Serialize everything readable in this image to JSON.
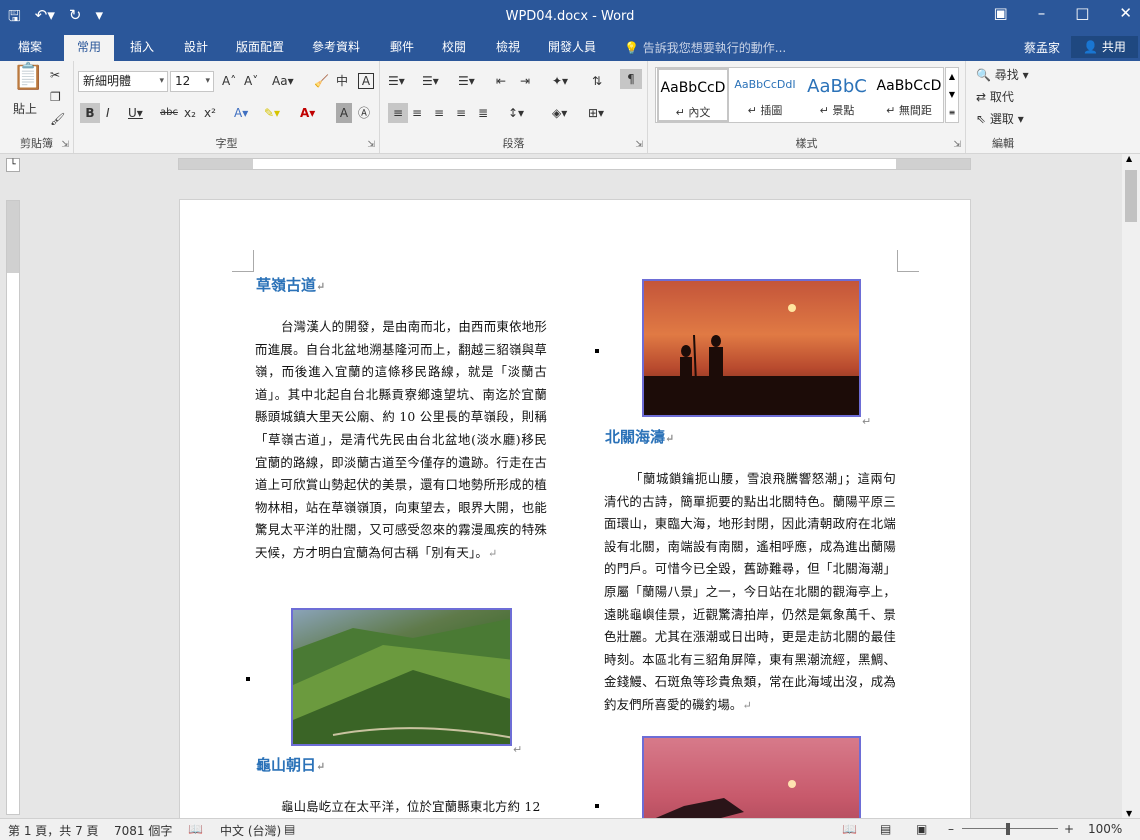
{
  "title": "WPD04.docx - Word",
  "tabs": [
    "檔案",
    "常用",
    "插入",
    "設計",
    "版面配置",
    "參考資料",
    "郵件",
    "校閱",
    "檢視",
    "開發人員"
  ],
  "tell_me": "告訴我您想要執行的動作...",
  "user": "蔡孟家",
  "share": "共用",
  "ribbon": {
    "paste": "貼上",
    "clipboard": "剪貼簿",
    "font_name": "新細明體",
    "font_size": "12",
    "font_group": "字型",
    "paragraph_group": "段落",
    "styles_group": "樣式",
    "editing_group": "編輯",
    "find": "尋找",
    "replace": "取代",
    "select": "選取",
    "styles": [
      {
        "preview": "AaBbCcD",
        "name": "↵ 內文"
      },
      {
        "preview": "AaBbCcDdI",
        "name": "↵ 插圖"
      },
      {
        "preview": "AaBbC",
        "name": "↵ 景點"
      },
      {
        "preview": "AaBbCcD",
        "name": "↵ 無間距"
      }
    ]
  },
  "document": {
    "heading1": "草嶺古道",
    "para1": "台灣漢人的開發，是由南而北，由西而東依地形而進展。自台北盆地溯基隆河而上，翻越三貂嶺與草嶺，而後進入宜蘭的這條移民路線，就是「淡蘭古道」。其中北起自台北縣貢寮鄉遠望坑、南迄於宜蘭縣頭城鎮大里天公廟、約 10 公里長的草嶺段，則稱「草嶺古道」，是清代先民由台北盆地(淡水廳)移民宜蘭的路線，即淡蘭古道至今僅存的遺跡。行走在古道上可欣賞山勢起伏的美景，還有口地勢所形成的植物林相，站在草嶺嶺頂，向東望去，眼界大開，也能驚見太平洋的壯闊，又可感受忽來的霧漫風疾的特殊天候，方才明白宜蘭為何古稱「別有天」。",
    "heading2": "龜山朝日",
    "para2": "龜山島屹立在太平洋，位於宜蘭縣東北方約 12",
    "heading3": "北關海濤",
    "para3": "「蘭城鎖鑰扼山腰，雪浪飛騰響怒潮」；這兩句清代的古詩，簡單扼要的點出北關特色。蘭陽平原三面環山，東臨大海，地形封閉，因此清朝政府在北端設有北關，南端設有南關，遙相呼應，成為進出蘭陽的門戶。可惜今已全毀，舊跡難尋，但「北關海潮」原屬「蘭陽八景」之一，今日站在北關的觀海亭上，遠眺龜嶼佳景，近觀驚濤拍岸，仍然是氣象萬千、景色壯麗。尤其在漲潮或日出時，更是走訪北關的最佳時刻。本區北有三貂角屏障，東有黑潮流經，黑鯛、金錢鰻、石斑魚等珍貴魚類，常在此海域出沒，成為釣友們所喜愛的磯釣場。"
  },
  "status": {
    "page": "第 1 頁，共 7 頁",
    "words": "7081 個字",
    "lang": "中文 (台灣)",
    "zoom": "100%"
  }
}
